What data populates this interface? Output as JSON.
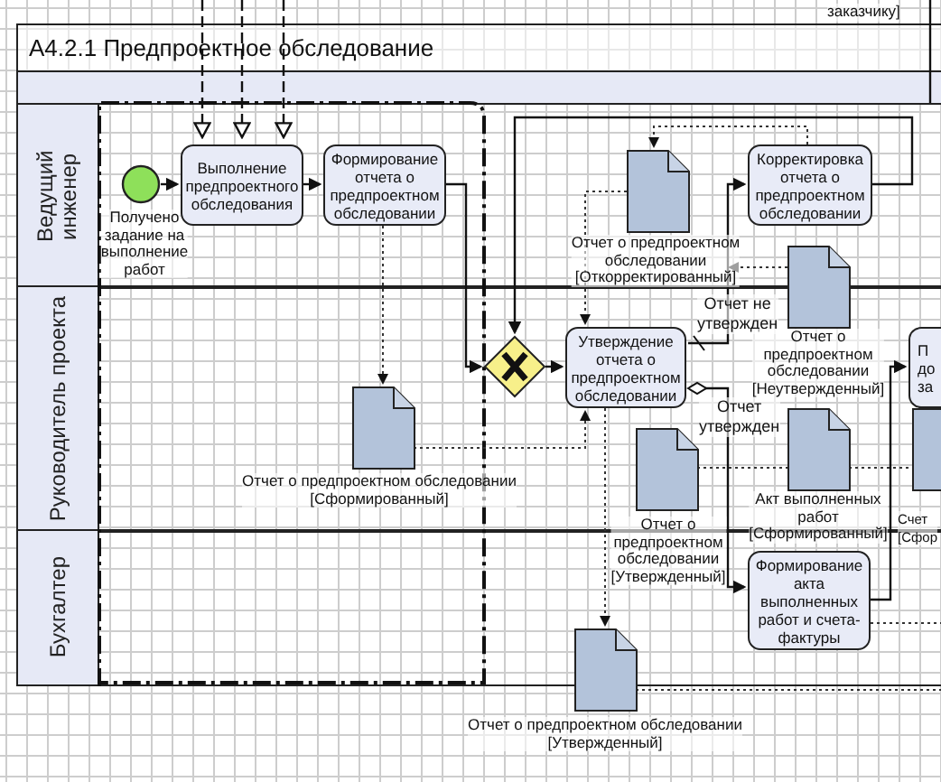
{
  "pool": {
    "title": "А4.2.1 Предпроектное обследование",
    "lanes": [
      {
        "label": "Ведущий инженер"
      },
      {
        "label": "Руководитель проекта"
      },
      {
        "label": "Бухгалтер"
      }
    ]
  },
  "nodes": [
    {
      "kind": "text",
      "label": "заказчику]"
    },
    {
      "kind": "start",
      "label": "Получено\nзадание на\nвыполнение\nработ"
    },
    {
      "kind": "task",
      "label": "Выполнение\nпредпроектного\nобследования"
    },
    {
      "kind": "task",
      "label": "Формирование\nотчета о\nпредпроектном\nобследовании"
    },
    {
      "kind": "document",
      "label": "Отчет о предпроектном\nобследовании\n[Откорректированный]"
    },
    {
      "kind": "task",
      "label": "Корректировка\nотчета о\nпредпроектном\nобследовании"
    },
    {
      "kind": "flow_label",
      "label": "Отчет не\nутвержден"
    },
    {
      "kind": "gateway"
    },
    {
      "kind": "task",
      "label": "Утверждение\nотчета о\nпредпроектном\nобследовании"
    },
    {
      "kind": "document",
      "label": "Отчет о\nпредпроектном\nобследовании\n[Неутвержденный]"
    },
    {
      "kind": "task",
      "label": "П\nдо\nза"
    },
    {
      "kind": "flow_label",
      "label": "Отчет\nутвержден"
    },
    {
      "kind": "document",
      "label": "Отчет о предпроектном обследовании\n[Сформированный]"
    },
    {
      "kind": "document",
      "label": "Отчет о\nпредпроектном\nобследовании\n[Утвержденный]"
    },
    {
      "kind": "document",
      "label": "Акт выполненных\nработ\n[Сформированный]"
    },
    {
      "kind": "document",
      "label": "Счет\n[Сфор"
    },
    {
      "kind": "task",
      "label": "Формирование\nакта\nвыполненных\nработ и счета-\nфактуры"
    },
    {
      "kind": "document",
      "label": "Отчет о предпроектном обследовании\n[Утвержденный]"
    }
  ]
}
